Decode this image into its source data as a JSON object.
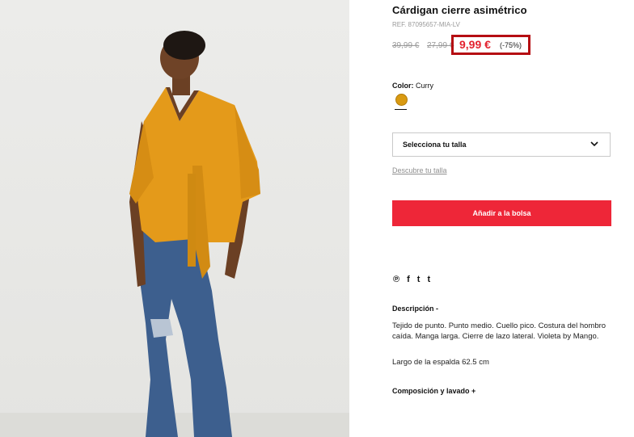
{
  "product": {
    "title": "Cárdigan cierre asimétrico",
    "ref": "REF. 87095657-MIA-LV",
    "old_price_1": "39,99 €",
    "old_price_2": "27,99 €",
    "price": "9,99 €",
    "discount": "(-75%)"
  },
  "color": {
    "label": "Color:",
    "value": "Curry",
    "swatch_hex": "#d99a12"
  },
  "size": {
    "select_label": "Selecciona tu talla",
    "guide_link": "Descubre tu talla"
  },
  "cart": {
    "add_label": "Añadir a la bolsa",
    "button_color": "#ee2638"
  },
  "social": {
    "icons": [
      "pinterest-icon",
      "facebook-icon",
      "twitter-icon",
      "tumblr-icon"
    ],
    "glyphs": [
      "℗",
      "f",
      "t",
      "t"
    ]
  },
  "description": {
    "heading": "Descripción -",
    "text": "Tejido de punto. Punto medio. Cuello pico. Costura del hombro caída. Manga larga. Cierre de lazo lateral. Violeta by Mango.",
    "back_length": "Largo de la espalda 62.5 cm"
  },
  "composition": {
    "heading": "Composición y lavado +"
  }
}
